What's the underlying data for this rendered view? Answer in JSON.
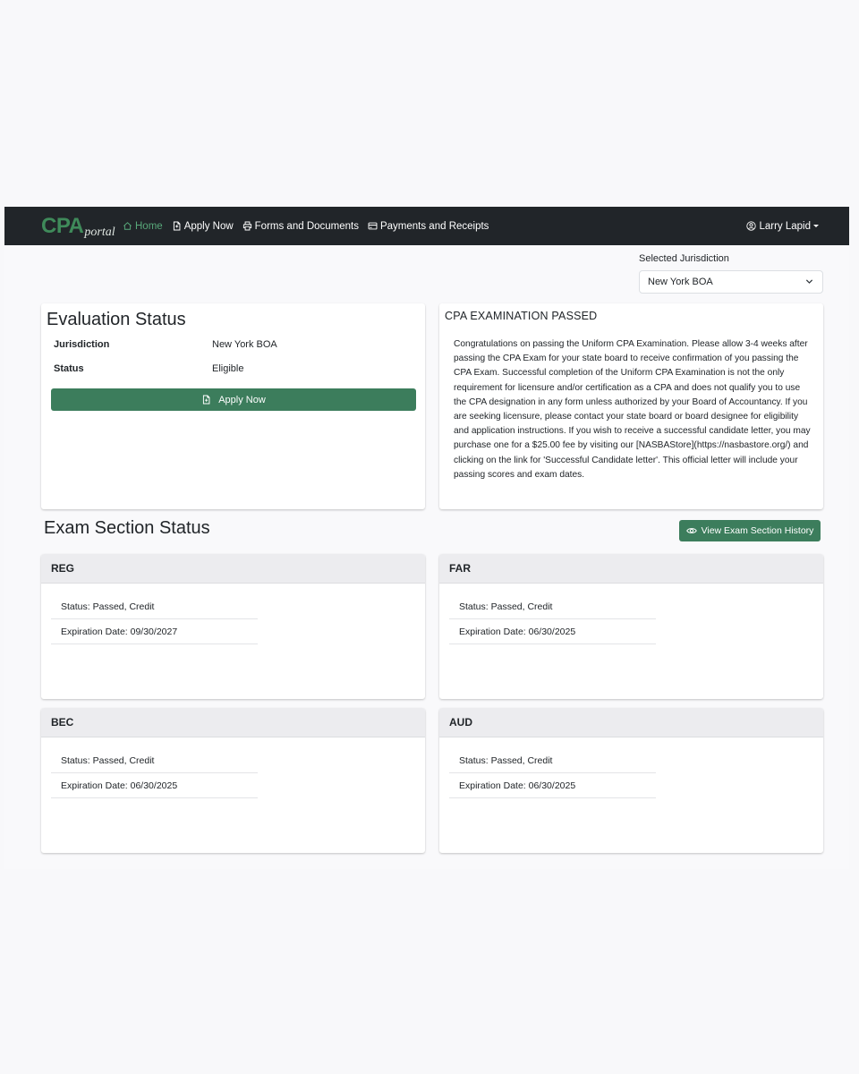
{
  "nav": {
    "brand_main": "CPA",
    "brand_sub": "portal",
    "items": [
      {
        "label": "Home",
        "icon": "home-icon"
      },
      {
        "label": "Apply Now",
        "icon": "file-icon"
      },
      {
        "label": "Forms and Documents",
        "icon": "printer-icon"
      },
      {
        "label": "Payments and Receipts",
        "icon": "credit-card-icon"
      }
    ],
    "user": "Larry Lapid"
  },
  "jurisdiction": {
    "label": "Selected Jurisdiction",
    "selected": "New York BOA"
  },
  "evaluation": {
    "title": "Evaluation Status",
    "jurisdiction_key": "Jurisdiction",
    "jurisdiction_value": "New York BOA",
    "status_key": "Status",
    "status_value": "Eligible",
    "apply_label": "Apply Now"
  },
  "passed": {
    "title": "CPA EXAMINATION PASSED",
    "body": "Congratulations on passing the Uniform CPA Examination. Please allow 3-4 weeks after passing the CPA Exam for your state board to receive confirmation of you passing the CPA Exam. Successful completion of the Uniform CPA Examination is not the only requirement for licensure and/or certification as a CPA and does not qualify you to use the CPA designation in any form unless authorized by your Board of Accountancy. If you are seeking licensure, please contact your state board or board designee for eligibility and application instructions. If you wish to receive a successful candidate letter, you may purchase one for a $25.00 fee by visiting our [NASBAStore](https://nasbastore.org/) and clicking on the link for 'Successful Candidate letter'. This official letter will include your passing scores and exam dates."
  },
  "exam": {
    "heading": "Exam Section Status",
    "history_label": "View Exam Section History",
    "sections": [
      {
        "name": "REG",
        "status": "Status: Passed, Credit",
        "expiration": "Expiration Date: 09/30/2027"
      },
      {
        "name": "FAR",
        "status": "Status: Passed, Credit",
        "expiration": "Expiration Date: 06/30/2025"
      },
      {
        "name": "BEC",
        "status": "Status: Passed, Credit",
        "expiration": "Expiration Date: 06/30/2025"
      },
      {
        "name": "AUD",
        "status": "Status: Passed, Credit",
        "expiration": "Expiration Date: 06/30/2025"
      }
    ]
  },
  "colors": {
    "navbar": "#212529",
    "accent_green": "#3c7d5c",
    "active_nav": "#58a87a"
  }
}
